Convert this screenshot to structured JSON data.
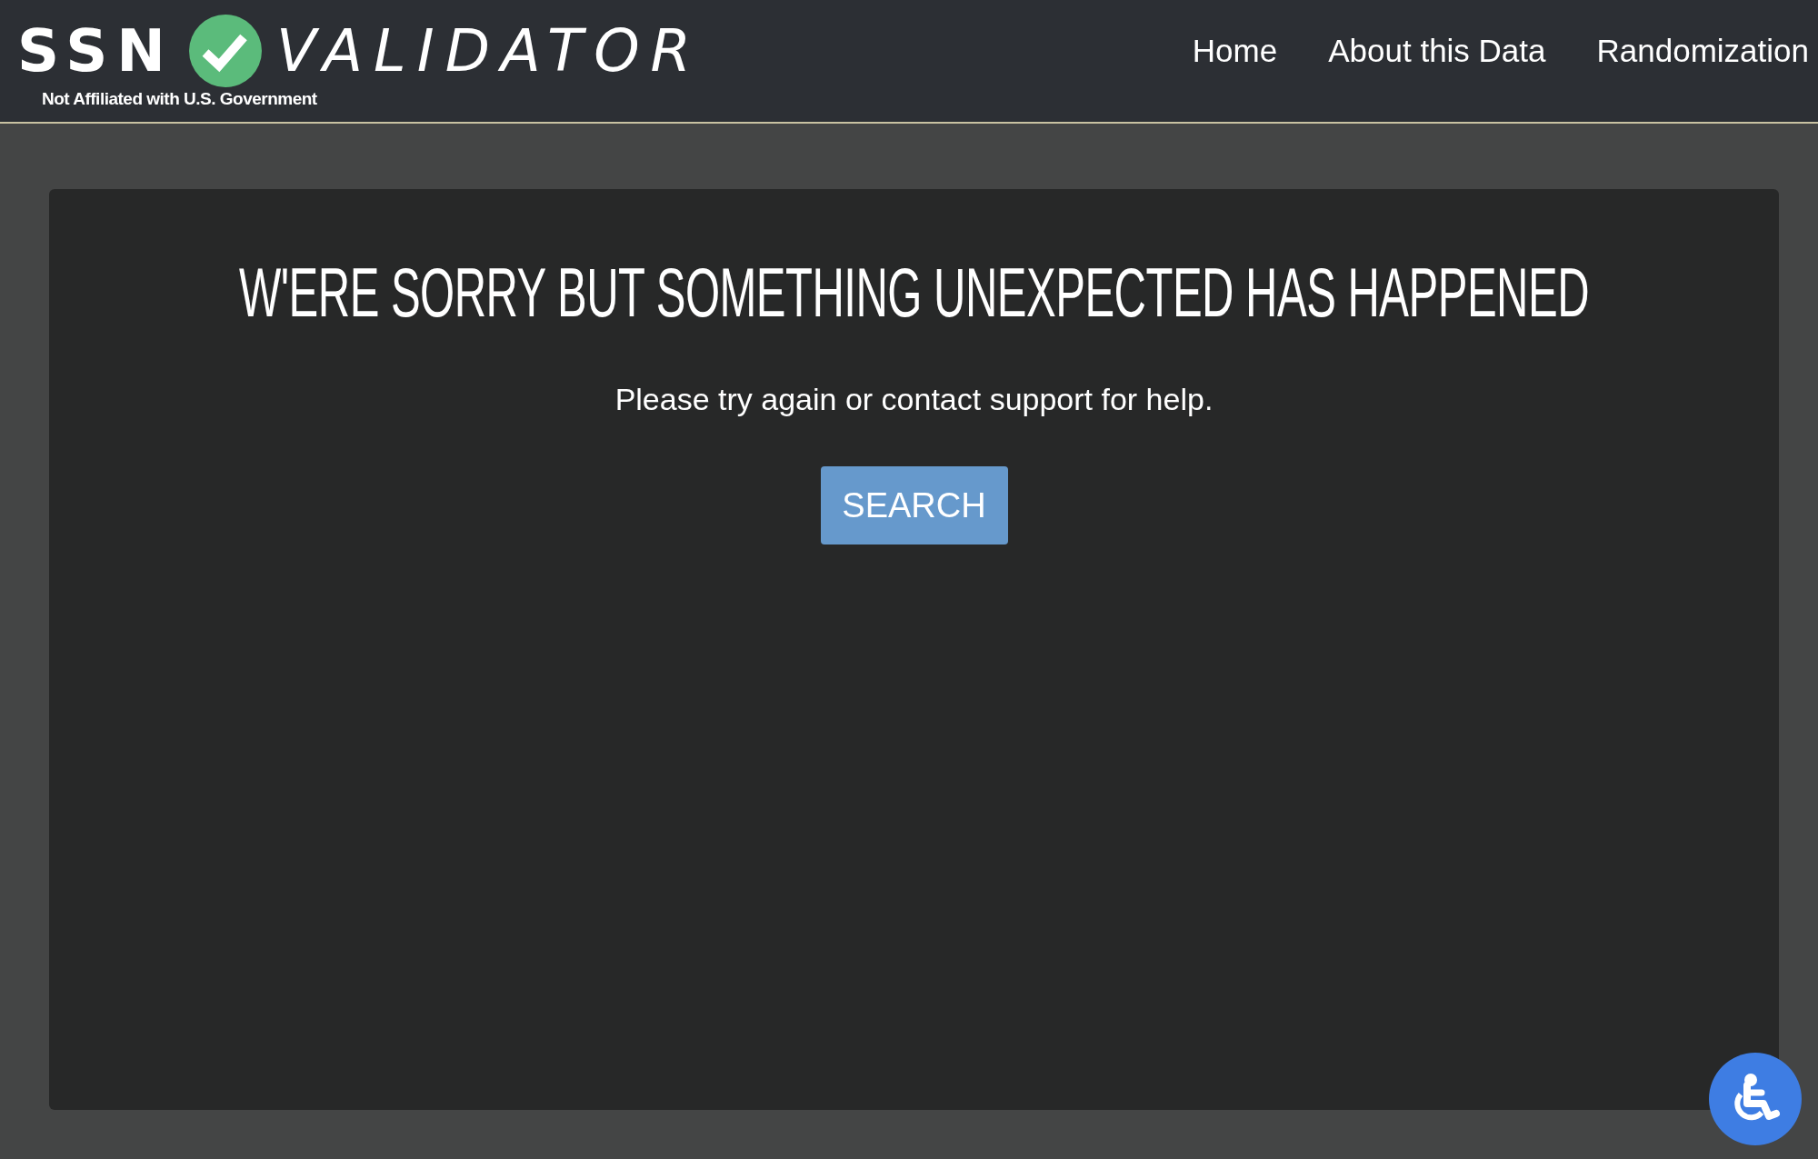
{
  "header": {
    "logo": {
      "left": "SSN",
      "right": "VALIDATOR"
    },
    "tagline": "Not Affiliated with U.S. Government",
    "nav": [
      {
        "label": "Home"
      },
      {
        "label": "About this Data"
      },
      {
        "label": "Randomization"
      }
    ]
  },
  "error": {
    "title": "W'ERE SORRY BUT SOMETHING UNEXPECTED HAS HAPPENED",
    "message": "Please try again or contact support for help.",
    "button": "SEARCH"
  }
}
